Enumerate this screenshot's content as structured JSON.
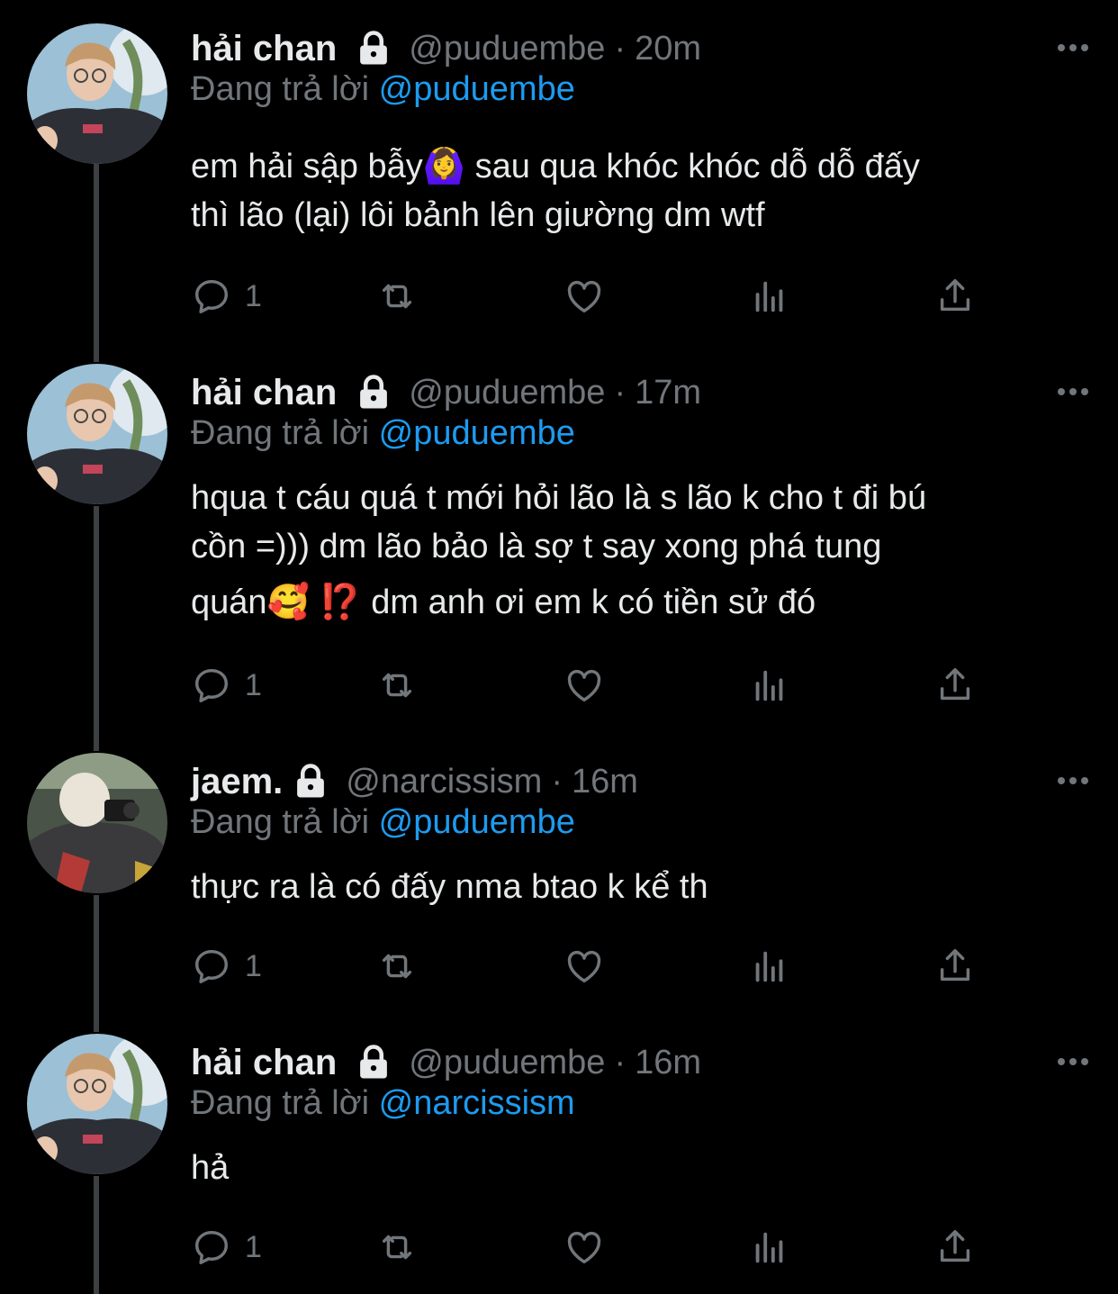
{
  "colors": {
    "background": "#000000",
    "text": "#e7e9ea",
    "muted": "#71767b",
    "accent": "#1d9bf0",
    "thread_line": "#3c4043"
  },
  "tweets": [
    {
      "name": "hải chan",
      "handle": "@puduembe",
      "time": "20m",
      "reply_prefix": "Đang trả lời",
      "reply_to": "@puduembe",
      "lines": [
        "em hải sập bẫy🙆‍♀️ sau qua khóc khóc dỗ dỗ đấy",
        "thì lão (lại) lôi bảnh lên giường dm wtf"
      ],
      "reply_count": "1",
      "avatar": "person-light-shirt"
    },
    {
      "name": "hải chan",
      "handle": "@puduembe",
      "time": "17m",
      "reply_prefix": "Đang trả lời",
      "reply_to": "@puduembe",
      "lines": [
        "hqua t cáu quá t mới hỏi lão là s lão k cho t đi bú",
        "cồn =))) dm lão bảo là sợ t say xong phá tung",
        "quán🥰 ⁉️ dm anh ơi em k có tiền sử đó"
      ],
      "reply_count": "1",
      "avatar": "person-light-shirt"
    },
    {
      "name": "jaem.",
      "handle": "@narcissism",
      "time": "16m",
      "reply_prefix": "Đang trả lời",
      "reply_to": "@puduembe",
      "lines": [
        "thực ra là có đấy nma btao k kể th"
      ],
      "reply_count": "1",
      "avatar": "person-camera"
    },
    {
      "name": "hải chan",
      "handle": "@puduembe",
      "time": "16m",
      "reply_prefix": "Đang trả lời",
      "reply_to": "@narcissism",
      "lines": [
        "hả"
      ],
      "reply_count": "1",
      "avatar": "person-light-shirt"
    }
  ],
  "icons": {
    "reply": "reply-icon",
    "retweet": "retweet-icon",
    "like": "like-icon",
    "views": "views-icon",
    "share": "share-icon",
    "lock": "lock-icon",
    "more": "more-icon"
  }
}
